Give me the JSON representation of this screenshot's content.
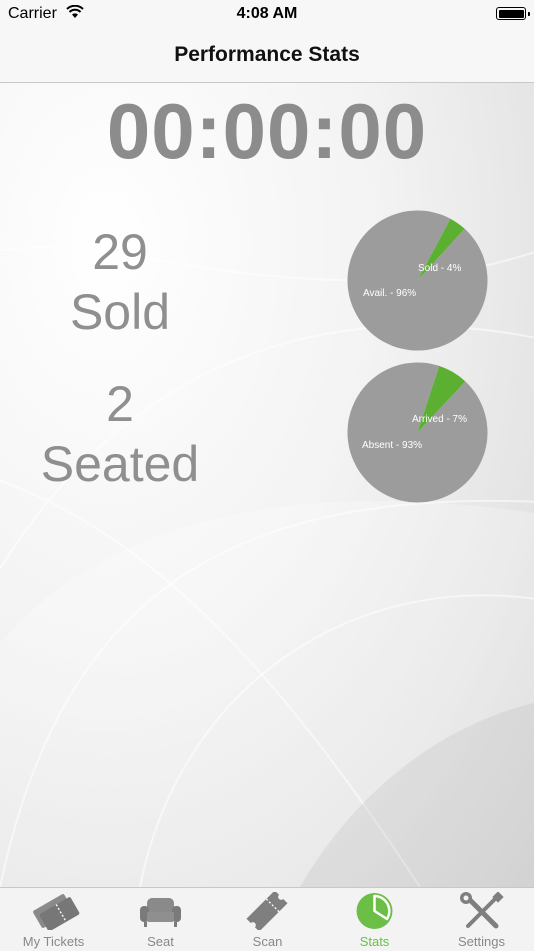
{
  "status_bar": {
    "carrier": "Carrier",
    "time": "4:08 AM"
  },
  "nav": {
    "title": "Performance Stats"
  },
  "timer": "00:00:00",
  "sold": {
    "count": "29",
    "label": "Sold"
  },
  "seated": {
    "count": "2",
    "label": "Seated"
  },
  "pies": [
    {
      "slices": [
        {
          "label": "Sold - 4%",
          "value": 4,
          "color": "#5bb031"
        },
        {
          "label": "Avail. - 96%",
          "value": 96,
          "color": "#9c9c9c"
        }
      ]
    },
    {
      "slices": [
        {
          "label": "Arrived - 7%",
          "value": 7,
          "color": "#5bb031"
        },
        {
          "label": "Absent - 93%",
          "value": 93,
          "color": "#9c9c9c"
        }
      ]
    }
  ],
  "tabs": [
    {
      "label": "My Tickets",
      "icon": "tickets-icon"
    },
    {
      "label": "Seat",
      "icon": "armchair-icon"
    },
    {
      "label": "Scan",
      "icon": "ticket-scan-icon"
    },
    {
      "label": "Stats",
      "icon": "pie-chart-icon",
      "active": true
    },
    {
      "label": "Settings",
      "icon": "wrench-screwdriver-icon"
    }
  ],
  "colors": {
    "accent": "#6bbf46",
    "stat_gray": "#8f8f8f"
  }
}
